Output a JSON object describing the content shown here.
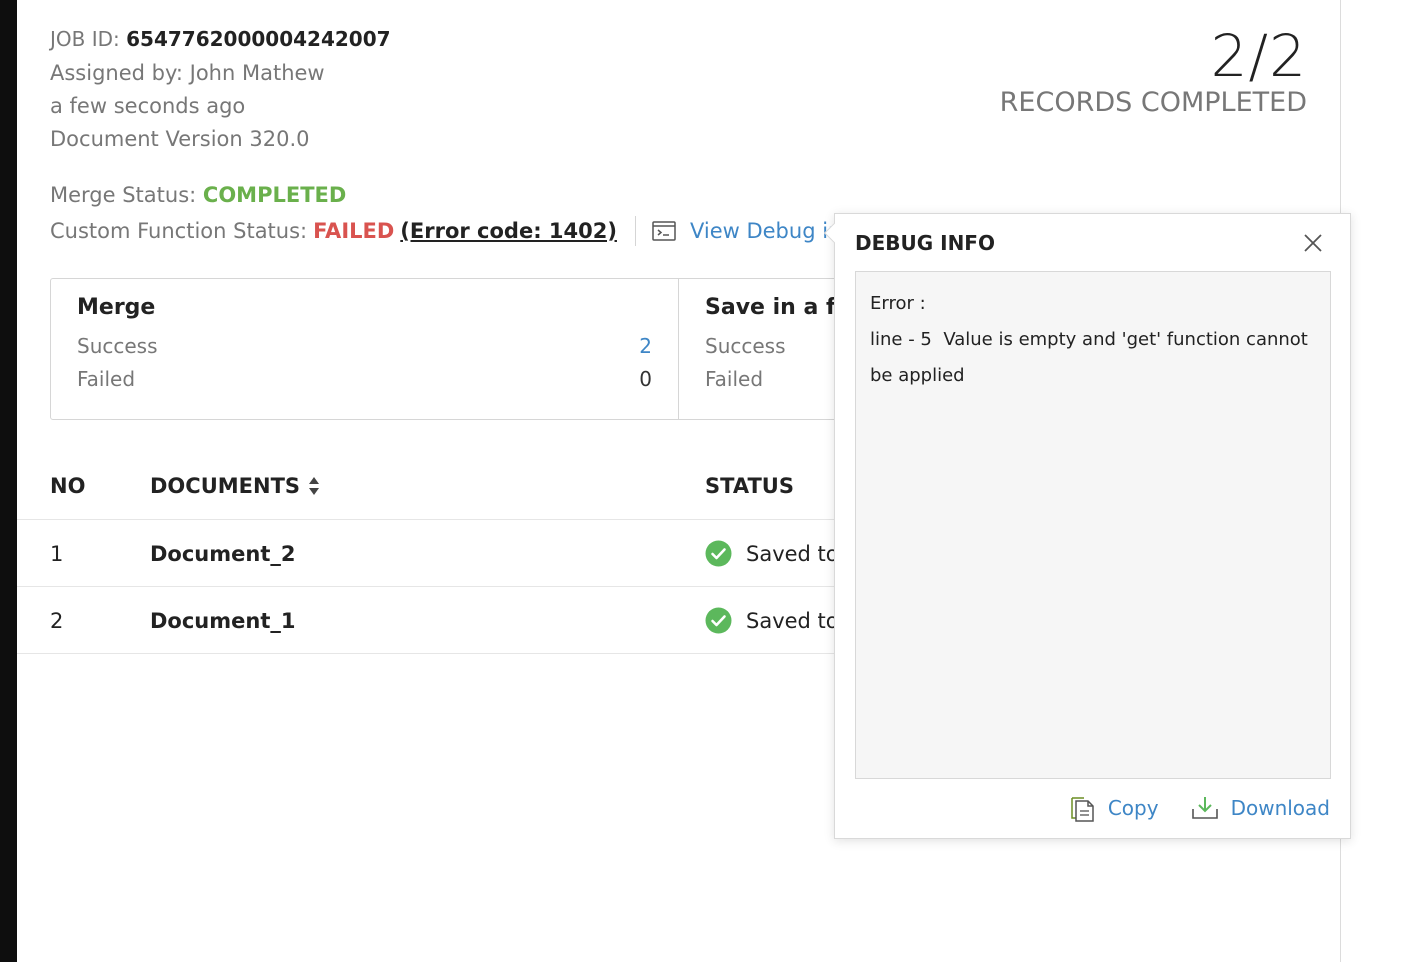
{
  "job": {
    "id_label": "JOB ID:",
    "id_value": "6547762000004242007",
    "assigned_label": "Assigned by:",
    "assigned_value": "John Mathew",
    "time_ago": "a few seconds ago",
    "doc_version_label": "Document Version",
    "doc_version_value": "320.0"
  },
  "status": {
    "merge_label": "Merge Status:",
    "merge_value": "COMPLETED",
    "cf_label": "Custom Function Status:",
    "cf_value": "FAILED",
    "error_code": "(Error code: 1402)",
    "debug_link": "View Debug info"
  },
  "records": {
    "count": "2/2",
    "label": "RECORDS COMPLETED"
  },
  "stats": {
    "merge": {
      "title": "Merge",
      "success_label": "Success",
      "success_value": "2",
      "failed_label": "Failed",
      "failed_value": "0"
    },
    "save": {
      "title": "Save in a folder",
      "success_label": "Success",
      "failed_label": "Failed"
    }
  },
  "table": {
    "headers": {
      "no": "NO",
      "documents": "DOCUMENTS",
      "status": "STATUS"
    },
    "rows": [
      {
        "no": "1",
        "document": "Document_2",
        "status": "Saved to"
      },
      {
        "no": "2",
        "document": "Document_1",
        "status": "Saved to"
      }
    ]
  },
  "debug_popup": {
    "title": "DEBUG INFO",
    "error_line1": "Error :",
    "error_line2": "line - 5  Value is empty and 'get' function cannot",
    "error_line3": "be applied",
    "copy_label": "Copy",
    "download_label": "Download"
  },
  "colors": {
    "accent_blue": "#3e86c6",
    "success_green": "#6ab04c",
    "error_red": "#d9534f"
  }
}
